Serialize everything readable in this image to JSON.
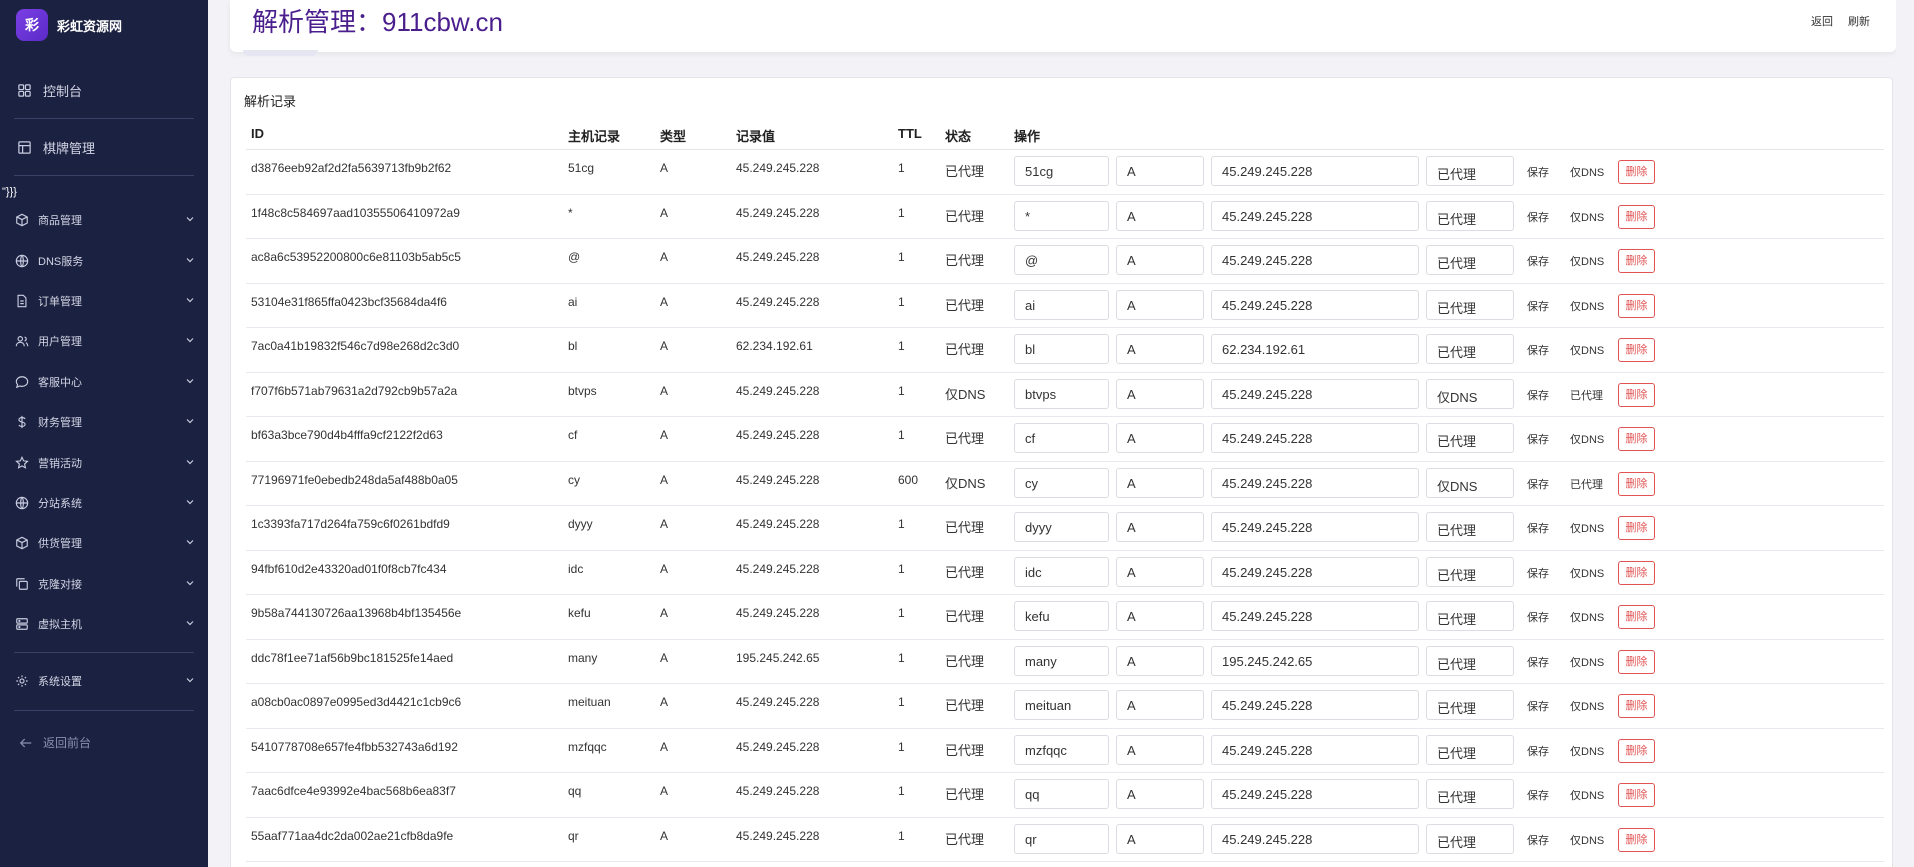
{
  "brand": {
    "logo_char": "彩",
    "name": "彩虹资源网"
  },
  "sidebar": {
    "top_items": [
      {
        "label": "控制台",
        "icon": "dashboard-icon"
      },
      {
        "label": "棋牌管理",
        "icon": "board-icon"
      }
    ],
    "stray_text": "\"}}}",
    "groups": [
      {
        "label": "商品管理",
        "icon": "box-icon"
      },
      {
        "label": "DNS服务",
        "icon": "globe-icon"
      },
      {
        "label": "订单管理",
        "icon": "document-icon"
      },
      {
        "label": "用户管理",
        "icon": "users-icon"
      },
      {
        "label": "客服中心",
        "icon": "chat-icon"
      },
      {
        "label": "财务管理",
        "icon": "dollar-icon"
      },
      {
        "label": "营销活动",
        "icon": "star-icon"
      },
      {
        "label": "分站系统",
        "icon": "globe-icon"
      },
      {
        "label": "供货管理",
        "icon": "box-icon"
      },
      {
        "label": "克隆对接",
        "icon": "copy-icon"
      },
      {
        "label": "虚拟主机",
        "icon": "server-icon"
      }
    ],
    "settings": {
      "label": "系统设置",
      "icon": "gear-icon"
    },
    "back": {
      "label": "返回前台",
      "icon": "arrow-left-icon"
    }
  },
  "header": {
    "title": "解析管理：911cbw.cn",
    "links": [
      "返回",
      "刷新"
    ]
  },
  "card": {
    "title": "解析记录",
    "columns": [
      "ID",
      "主机记录",
      "类型",
      "记录值",
      "TTL",
      "状态",
      "操作"
    ],
    "actions": {
      "save": "保存",
      "delete": "删除"
    }
  },
  "records": [
    {
      "id": "d3876eeb92af2d2fa5639713fb9b2f62",
      "host": "51cg",
      "type": "A",
      "value": "45.249.245.228",
      "ttl": "1",
      "status": "已代理",
      "toggle": "仅DNS"
    },
    {
      "id": "1f48c8c584697aad10355506410972a9",
      "host": "*",
      "type": "A",
      "value": "45.249.245.228",
      "ttl": "1",
      "status": "已代理",
      "toggle": "仅DNS"
    },
    {
      "id": "ac8a6c53952200800c6e81103b5ab5c5",
      "host": "@",
      "type": "A",
      "value": "45.249.245.228",
      "ttl": "1",
      "status": "已代理",
      "toggle": "仅DNS"
    },
    {
      "id": "53104e31f865ffa0423bcf35684da4f6",
      "host": "ai",
      "type": "A",
      "value": "45.249.245.228",
      "ttl": "1",
      "status": "已代理",
      "toggle": "仅DNS"
    },
    {
      "id": "7ac0a41b19832f546c7d98e268d2c3d0",
      "host": "bl",
      "type": "A",
      "value": "62.234.192.61",
      "ttl": "1",
      "status": "已代理",
      "toggle": "仅DNS"
    },
    {
      "id": "f707f6b571ab79631a2d792cb9b57a2a",
      "host": "btvps",
      "type": "A",
      "value": "45.249.245.228",
      "ttl": "1",
      "status": "仅DNS",
      "toggle": "已代理"
    },
    {
      "id": "bf63a3bce790d4b4fffa9cf2122f2d63",
      "host": "cf",
      "type": "A",
      "value": "45.249.245.228",
      "ttl": "1",
      "status": "已代理",
      "toggle": "仅DNS"
    },
    {
      "id": "77196971fe0ebedb248da5af488b0a05",
      "host": "cy",
      "type": "A",
      "value": "45.249.245.228",
      "ttl": "600",
      "status": "仅DNS",
      "toggle": "已代理"
    },
    {
      "id": "1c3393fa717d264fa759c6f0261bdfd9",
      "host": "dyyy",
      "type": "A",
      "value": "45.249.245.228",
      "ttl": "1",
      "status": "已代理",
      "toggle": "仅DNS"
    },
    {
      "id": "94fbf610d2e43320ad01f0f8cb7fc434",
      "host": "idc",
      "type": "A",
      "value": "45.249.245.228",
      "ttl": "1",
      "status": "已代理",
      "toggle": "仅DNS"
    },
    {
      "id": "9b58a744130726aa13968b4bf135456e",
      "host": "kefu",
      "type": "A",
      "value": "45.249.245.228",
      "ttl": "1",
      "status": "已代理",
      "toggle": "仅DNS"
    },
    {
      "id": "ddc78f1ee71af56b9bc181525fe14aed",
      "host": "many",
      "type": "A",
      "value": "195.245.242.65",
      "ttl": "1",
      "status": "已代理",
      "toggle": "仅DNS"
    },
    {
      "id": "a08cb0ac0897e0995ed3d4421c1cb9c6",
      "host": "meituan",
      "type": "A",
      "value": "45.249.245.228",
      "ttl": "1",
      "status": "已代理",
      "toggle": "仅DNS"
    },
    {
      "id": "5410778708e657fe4fbb532743a6d192",
      "host": "mzfqqc",
      "type": "A",
      "value": "45.249.245.228",
      "ttl": "1",
      "status": "已代理",
      "toggle": "仅DNS"
    },
    {
      "id": "7aac6dfce4e93992e4bac568b6ea83f7",
      "host": "qq",
      "type": "A",
      "value": "45.249.245.228",
      "ttl": "1",
      "status": "已代理",
      "toggle": "仅DNS"
    },
    {
      "id": "55aaf771aa4dc2da002ae21cfb8da9fe",
      "host": "qr",
      "type": "A",
      "value": "45.249.245.228",
      "ttl": "1",
      "status": "已代理",
      "toggle": "仅DNS"
    }
  ],
  "colors": {
    "sidebar_bg": "#1b2140",
    "title": "#4a1e8c",
    "danger": "#e25353",
    "brand": "#7b3fe4"
  }
}
